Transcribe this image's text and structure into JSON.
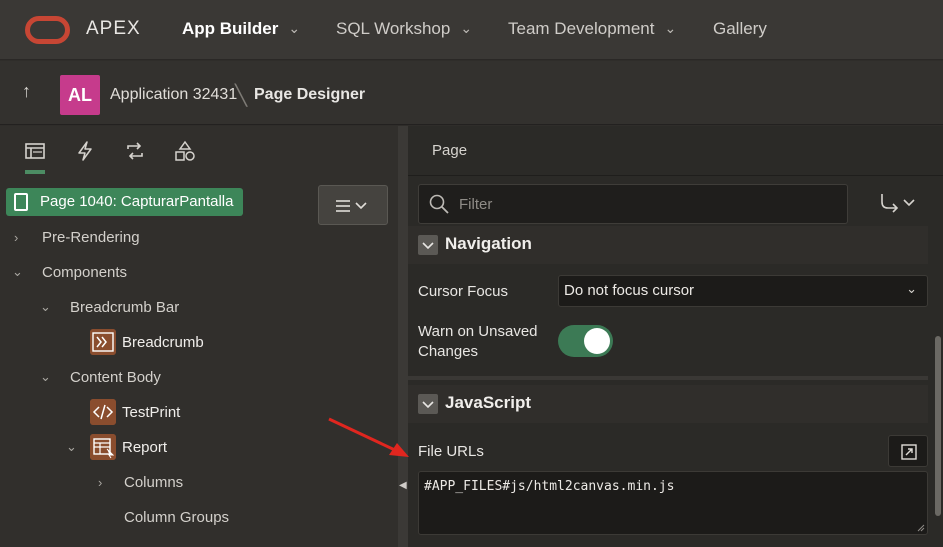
{
  "topnav": {
    "brand": "APEX",
    "items": [
      {
        "label": "App Builder",
        "has_menu": true,
        "active": true
      },
      {
        "label": "SQL Workshop",
        "has_menu": true,
        "active": false
      },
      {
        "label": "Team Development",
        "has_menu": true,
        "active": false
      },
      {
        "label": "Gallery",
        "has_menu": false,
        "active": false
      }
    ]
  },
  "breadcrumb": {
    "avatar_initials": "AL",
    "avatar_color": "#c63b8c",
    "application": "Application 32431",
    "current": "Page Designer"
  },
  "left_pane": {
    "tabs": [
      "rendering-icon",
      "dynamic-actions-icon",
      "processing-icon",
      "shared-components-icon"
    ],
    "page_node": "Page 1040: CapturarPantalla",
    "tree": [
      {
        "label": "Pre-Rendering",
        "expanded": false
      },
      {
        "label": "Components",
        "expanded": true
      },
      {
        "label": "Breadcrumb Bar",
        "expanded": true
      },
      {
        "label": "Breadcrumb",
        "icon": "breadcrumb-region-icon"
      },
      {
        "label": "Content Body",
        "expanded": true
      },
      {
        "label": "TestPrint",
        "icon": "static-content-icon"
      },
      {
        "label": "Report",
        "icon": "report-region-icon",
        "expanded": true
      },
      {
        "label": "Columns",
        "expanded": false
      },
      {
        "label": "Column Groups"
      }
    ]
  },
  "right_pane": {
    "tab": "Page",
    "filter_placeholder": "Filter",
    "navigation": {
      "title": "Navigation",
      "cursor_focus_label": "Cursor Focus",
      "cursor_focus_value": "Do not focus cursor",
      "warn_label_line1": "Warn on Unsaved",
      "warn_label_line2": "Changes",
      "warn_enabled": true
    },
    "javascript": {
      "title": "JavaScript",
      "file_urls_label": "File URLs",
      "file_urls_value": "#APP_FILES#js/html2canvas.min.js"
    }
  },
  "colors": {
    "accent_green": "#3d8659",
    "oracle_red": "#c74634",
    "annotation_red": "#e0261f"
  }
}
